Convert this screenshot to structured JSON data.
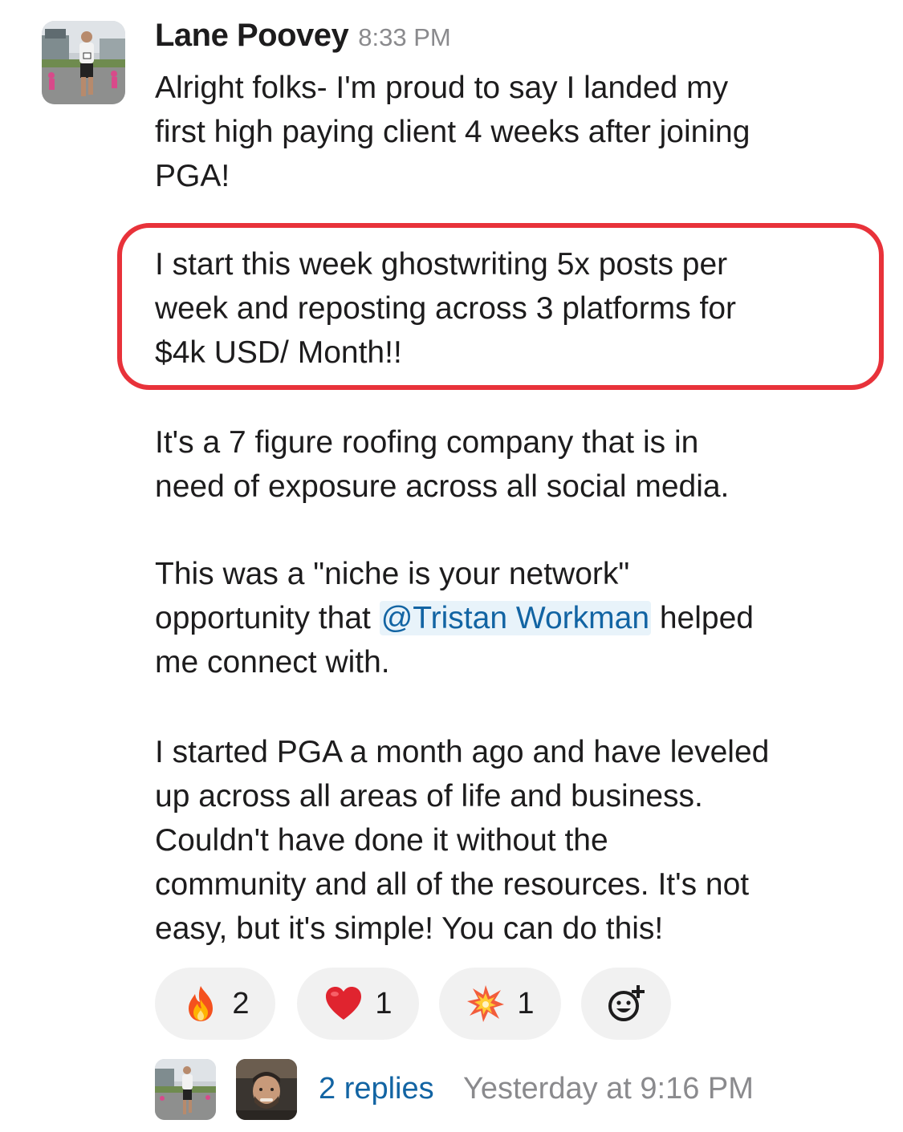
{
  "message": {
    "author": "Lane Poovey",
    "timestamp": "8:33 PM",
    "paragraphs": {
      "p1": [
        "Alright folks- I'm proud to say I landed my",
        "first high paying client 4 weeks after joining",
        "PGA!"
      ],
      "p2": [
        "I start this week ghostwriting 5x posts per",
        "week and reposting across 3 platforms for",
        "$4k USD/ Month!!"
      ],
      "p3": [
        "It's a 7 figure roofing company that is in",
        "need of exposure across all social media."
      ],
      "p4": {
        "line1": "This was a \"niche is your network\"",
        "line2_before": "opportunity that ",
        "mention": "@Tristan Workman",
        "line2_after": " helped",
        "line3": "me connect with."
      },
      "p5": [
        "I started PGA a month ago and have leveled",
        "up across all areas of life and business.",
        "Couldn't have done it without the",
        "community and all of the resources. It's not",
        "easy, but it's simple! You can do this!"
      ]
    },
    "highlight_color": "#e8323a"
  },
  "reactions": [
    {
      "emoji": "fire-emoji",
      "count": "2"
    },
    {
      "emoji": "heart-emoji",
      "count": "1"
    },
    {
      "emoji": "collision-emoji",
      "count": "1"
    },
    {
      "emoji": "add-reaction-icon"
    }
  ],
  "thread": {
    "replies_label": "2 replies",
    "last_reply": "Yesterday at 9:16 PM"
  },
  "colors": {
    "link": "#1264a3",
    "mention_bg": "#e8f3fa",
    "muted": "#8a8a8d",
    "reaction_bg": "#f1f1f1"
  }
}
